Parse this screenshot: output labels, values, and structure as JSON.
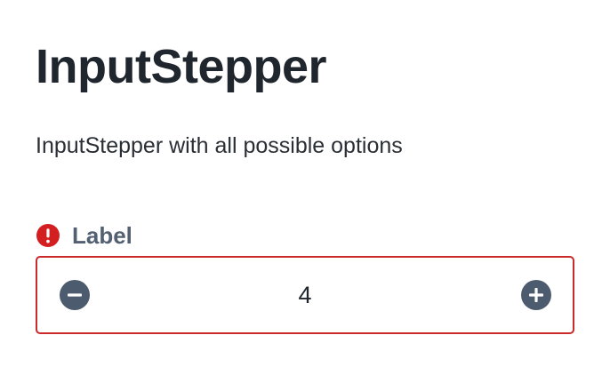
{
  "page": {
    "title": "InputStepper",
    "description": "InputStepper with all possible options"
  },
  "stepper": {
    "label": "Label",
    "value": "4",
    "status": "error",
    "icons": {
      "status": "error-icon",
      "decrement": "minus-circle-icon",
      "increment": "plus-circle-icon"
    },
    "colors": {
      "error": "#d31f1f",
      "border": "#c92a2a",
      "icon": "#4d5b6f",
      "label": "#536072"
    }
  }
}
